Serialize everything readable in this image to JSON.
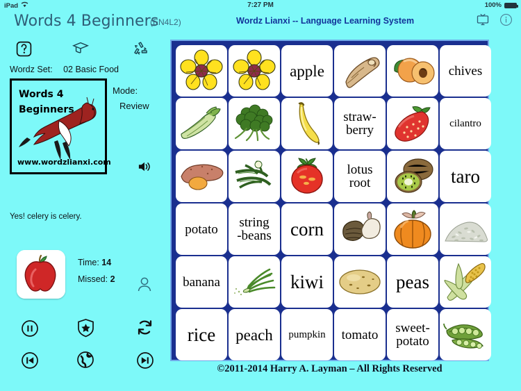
{
  "statusbar": {
    "device": "iPad",
    "wifi_icon": "wifi-icon",
    "time": "7:27 PM",
    "battery_percent": "100%",
    "battery_icon": "battery-full-icon"
  },
  "header": {
    "app_title": "Words 4 Beginners",
    "app_code": "(EN4L2)",
    "system_title": "Wordz Lianxi -- Language Learning System",
    "tv_icon": "tv-icon",
    "info_icon": "info-icon"
  },
  "sidebar": {
    "icons": [
      {
        "name": "help-icon",
        "label": "?"
      },
      {
        "name": "graduation-cap-icon",
        "label": ""
      },
      {
        "name": "recycle-icon",
        "label": ""
      }
    ],
    "wordz_set_label": "Wordz Set:",
    "wordz_set_value": "02 Basic Food",
    "logo": {
      "line1": "Words 4",
      "line2": "Beginners",
      "url": "www.wordzlianxi.com",
      "mascot_icon": "deer-mascot-icon"
    },
    "mode_label": "Mode:",
    "mode_value": "Review",
    "speaker_icon": "speaker-icon",
    "feedback": "Yes! celery is celery.",
    "thumbnail_icon": "apple-thumbnail-icon",
    "time_label": "Time:",
    "time_value": "14",
    "missed_label": "Missed:",
    "missed_value": "2",
    "user_icon": "user-icon",
    "controls": [
      {
        "name": "pause-button",
        "icon": "pause-circle-icon"
      },
      {
        "name": "badge-button",
        "icon": "shield-star-icon"
      },
      {
        "name": "refresh-button",
        "icon": "refresh-icon"
      },
      {
        "name": "first-button",
        "icon": "skip-back-circle-icon"
      },
      {
        "name": "globe-button",
        "icon": "globe-icon"
      },
      {
        "name": "last-button",
        "icon": "skip-forward-circle-icon"
      }
    ]
  },
  "board": {
    "frame_color": "#1a2f8f",
    "cells": [
      {
        "type": "image",
        "icon": "yellow-flower-icon",
        "word": ""
      },
      {
        "type": "image",
        "icon": "yellow-flower-icon",
        "word": ""
      },
      {
        "type": "word",
        "icon": "",
        "word": "apple",
        "size": "w-lg"
      },
      {
        "type": "image",
        "icon": "ginger-icon",
        "word": ""
      },
      {
        "type": "image",
        "icon": "peach-icon",
        "word": ""
      },
      {
        "type": "word",
        "icon": "",
        "word": "chives",
        "size": "w-md"
      },
      {
        "type": "image",
        "icon": "celery-icon",
        "word": ""
      },
      {
        "type": "image",
        "icon": "cilantro-icon",
        "word": ""
      },
      {
        "type": "image",
        "icon": "banana-icon",
        "word": ""
      },
      {
        "type": "word",
        "icon": "",
        "word": "straw-\nberry",
        "size": "w-md"
      },
      {
        "type": "image",
        "icon": "strawberry-icon",
        "word": ""
      },
      {
        "type": "word",
        "icon": "",
        "word": "cilantro",
        "size": "w-sm"
      },
      {
        "type": "image",
        "icon": "sweet-potato-icon",
        "word": ""
      },
      {
        "type": "image",
        "icon": "string-beans-icon",
        "word": ""
      },
      {
        "type": "image",
        "icon": "tomato-icon",
        "word": ""
      },
      {
        "type": "word",
        "icon": "",
        "word": "lotus\nroot",
        "size": "w-md"
      },
      {
        "type": "image",
        "icon": "kiwi-icon",
        "word": ""
      },
      {
        "type": "word",
        "icon": "",
        "word": "taro",
        "size": "w-xl"
      },
      {
        "type": "word",
        "icon": "",
        "word": "potato",
        "size": "w-md"
      },
      {
        "type": "word",
        "icon": "",
        "word": "string\n-beans",
        "size": "w-md"
      },
      {
        "type": "word",
        "icon": "",
        "word": "corn",
        "size": "w-xl"
      },
      {
        "type": "image",
        "icon": "taro-root-icon",
        "word": ""
      },
      {
        "type": "image",
        "icon": "pumpkin-icon",
        "word": ""
      },
      {
        "type": "image",
        "icon": "rice-pile-icon",
        "word": ""
      },
      {
        "type": "word",
        "icon": "",
        "word": "banana",
        "size": "w-md"
      },
      {
        "type": "image",
        "icon": "chives-icon",
        "word": ""
      },
      {
        "type": "word",
        "icon": "",
        "word": "kiwi",
        "size": "w-xl"
      },
      {
        "type": "image",
        "icon": "potato-icon",
        "word": ""
      },
      {
        "type": "word",
        "icon": "",
        "word": "peas",
        "size": "w-xl"
      },
      {
        "type": "image",
        "icon": "corn-icon",
        "word": ""
      },
      {
        "type": "word",
        "icon": "",
        "word": "rice",
        "size": "w-xl"
      },
      {
        "type": "word",
        "icon": "",
        "word": "peach",
        "size": "w-lg"
      },
      {
        "type": "word",
        "icon": "",
        "word": "pumpkin",
        "size": "w-sm"
      },
      {
        "type": "word",
        "icon": "",
        "word": "tomato",
        "size": "w-md"
      },
      {
        "type": "word",
        "icon": "",
        "word": "sweet-\npotato",
        "size": "w-md"
      },
      {
        "type": "image",
        "icon": "peas-icon",
        "word": ""
      }
    ]
  },
  "copyright": "©2011-2014 Harry A. Layman – All Rights Reserved"
}
